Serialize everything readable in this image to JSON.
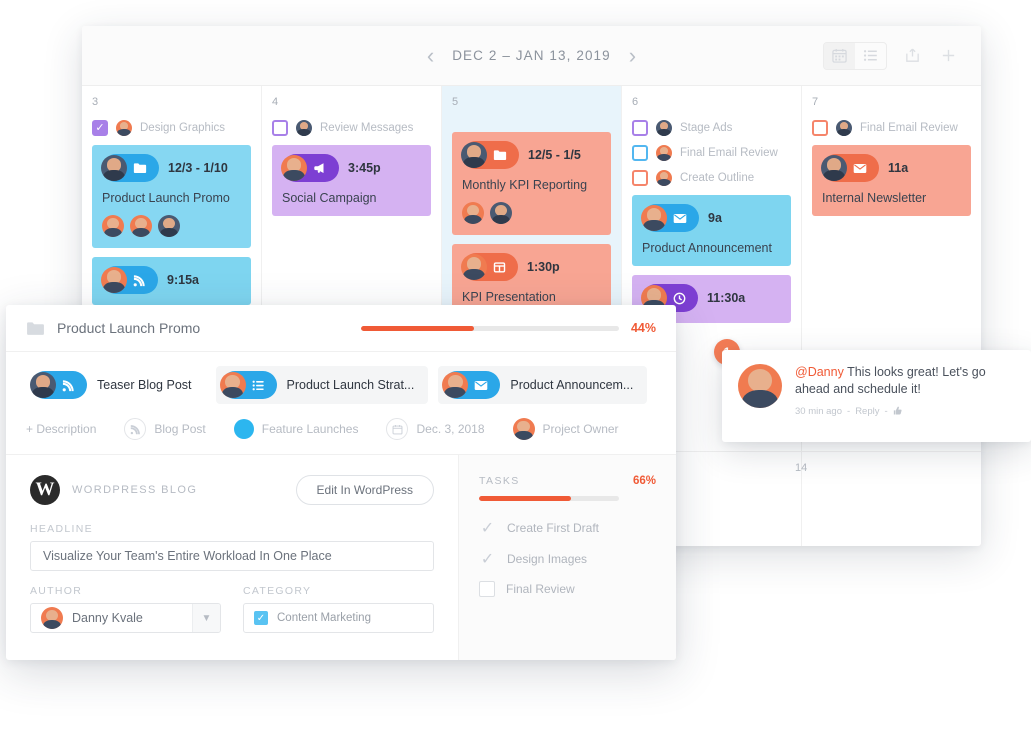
{
  "calendar": {
    "nav": {
      "prev": "‹",
      "next": "›",
      "date_range": "DEC 2 – JAN 13, 2019"
    },
    "tools": {
      "calendar_view": "calendar-icon",
      "list_view": "list-icon",
      "share": "share-icon",
      "add": "+"
    },
    "days": [
      {
        "num": "3",
        "tinted": false,
        "todos": [
          {
            "label": "Design Graphics",
            "state": "checked",
            "color": "purple"
          }
        ],
        "events": [
          {
            "time": "12/3 - 1/10",
            "title": "Product Launch Promo",
            "color": "blue",
            "pill": "b",
            "icon": "folder-icon",
            "avatars": 3
          },
          {
            "time": "9:15a",
            "title": "",
            "color": "cyan",
            "pill": "b",
            "icon": "rss-icon",
            "avatars": 0
          }
        ]
      },
      {
        "num": "4",
        "tinted": false,
        "todos": [
          {
            "label": "Review Messages",
            "state": "unchecked",
            "color": "purple"
          }
        ],
        "events": [
          {
            "time": "3:45p",
            "title": "Social Campaign",
            "color": "purple",
            "pill": "p",
            "icon": "megaphone-icon",
            "avatars": 0
          }
        ]
      },
      {
        "num": "5",
        "tinted": true,
        "todos": [],
        "events": [
          {
            "time": "12/5 - 1/5",
            "title": "Monthly KPI Reporting",
            "color": "coral",
            "pill": "o",
            "icon": "folder-icon",
            "avatars": 2
          },
          {
            "time": "1:30p",
            "title": "KPI Presentation",
            "color": "coral",
            "pill": "o",
            "icon": "presentation-icon",
            "avatars": 0
          }
        ]
      },
      {
        "num": "6",
        "tinted": false,
        "todos": [
          {
            "label": "Stage Ads",
            "state": "unchecked",
            "color": "purple"
          },
          {
            "label": "Final Email Review",
            "state": "unchecked",
            "color": "blue"
          },
          {
            "label": "Create Outline",
            "state": "unchecked",
            "color": "orange"
          }
        ],
        "events": [
          {
            "time": "9a",
            "title": "Product Announcement",
            "color": "cyan",
            "pill": "b",
            "icon": "envelope-icon",
            "avatars": 0
          },
          {
            "time": "11:30a",
            "title": "",
            "color": "purple",
            "pill": "p",
            "icon": "clock-icon",
            "avatars": 0
          }
        ]
      },
      {
        "num": "7",
        "tinted": false,
        "todos": [
          {
            "label": "Final Email Review",
            "state": "unchecked",
            "color": "orange"
          }
        ],
        "events": [
          {
            "time": "11a",
            "title": "Internal Newsletter",
            "color": "coral",
            "pill": "o",
            "icon": "envelope-icon",
            "avatars": 0
          }
        ]
      }
    ],
    "second_row_day": "14"
  },
  "detail": {
    "folder_icon": "folder-icon",
    "title": "Product Launch Promo",
    "progress_pct": 44,
    "progress_label": "44%",
    "chips": [
      {
        "label": "Teaser Blog Post",
        "icon": "rss-icon",
        "pill": "b",
        "bg": false
      },
      {
        "label": "Product Launch Strat...",
        "icon": "list-icon",
        "pill": "lb",
        "bg": true
      },
      {
        "label": "Product Announcem...",
        "icon": "envelope-icon",
        "pill": "lb",
        "bg": true
      }
    ],
    "meta": [
      {
        "label": "+ Description",
        "icon": "plus-icon"
      },
      {
        "label": "Blog Post",
        "icon": "rss-icon"
      },
      {
        "label": "Feature Launches",
        "icon": "color-dot"
      },
      {
        "label": "Dec. 3, 2018",
        "icon": "calendar-icon"
      },
      {
        "label": "Project Owner",
        "icon": "avatar"
      }
    ],
    "wordpress": {
      "mark": "W",
      "name": "WORDPRESS BLOG",
      "edit_button": "Edit In WordPress",
      "headline_label": "HEADLINE",
      "headline_value": "Visualize Your Team's Entire Workload In One Place",
      "author_label": "AUTHOR",
      "author_value": "Danny Kvale",
      "author_caret": "chevron-down-icon",
      "category_label": "CATEGORY",
      "category_value": "Content Marketing",
      "category_checked": true
    },
    "tasks": {
      "label": "TASKS",
      "pct_label": "66%",
      "pct": 66,
      "items": [
        {
          "label": "Create First Draft",
          "done": true
        },
        {
          "label": "Design Images",
          "done": true
        },
        {
          "label": "Final Review",
          "done": false
        }
      ]
    }
  },
  "comment": {
    "badge": "1",
    "mention": "@Danny",
    "body": " This looks great! Let's go ahead and schedule it!",
    "time": "30 min ago",
    "separator1": "-",
    "reply": "Reply",
    "separator2": "-",
    "like_icon": "thumbs-up-icon"
  },
  "colors": {
    "accent_orange": "#f05a36",
    "blue": "#2ba7e8",
    "purple": "#7d3fd3",
    "coral": "#f8a593",
    "cyan": "#7ed5f0"
  }
}
